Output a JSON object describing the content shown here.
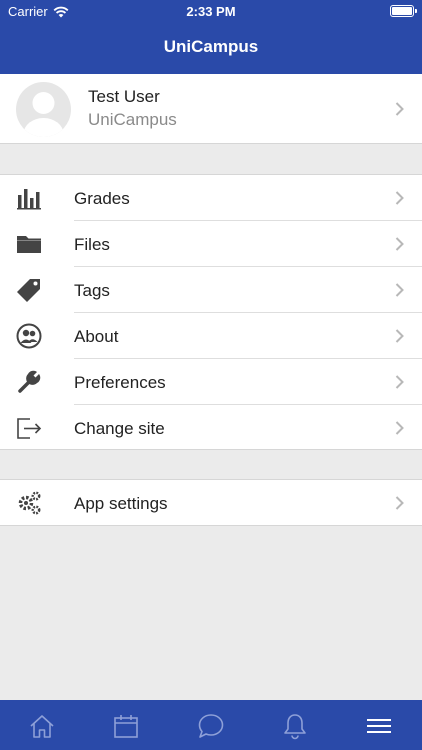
{
  "status_bar": {
    "carrier": "Carrier",
    "time": "2:33 PM"
  },
  "header": {
    "title": "UniCampus"
  },
  "profile": {
    "name": "Test User",
    "site": "UniCampus"
  },
  "menu": [
    {
      "label": "Grades",
      "icon": "bar-chart-icon"
    },
    {
      "label": "Files",
      "icon": "folder-icon"
    },
    {
      "label": "Tags",
      "icon": "tag-icon"
    },
    {
      "label": "About",
      "icon": "people-circle-icon"
    },
    {
      "label": "Preferences",
      "icon": "wrench-icon"
    },
    {
      "label": "Change site",
      "icon": "exit-icon"
    }
  ],
  "settings": {
    "label": "App settings",
    "icon": "cogs-icon"
  },
  "tabbar": {
    "tabs": [
      "home-icon",
      "calendar-icon",
      "messages-icon",
      "notifications-icon",
      "menu-icon"
    ],
    "selected": "menu-icon"
  },
  "colors": {
    "brand": "#2a4aa9",
    "background": "#ebebeb",
    "inactive_tab": "#8ea0d8"
  }
}
